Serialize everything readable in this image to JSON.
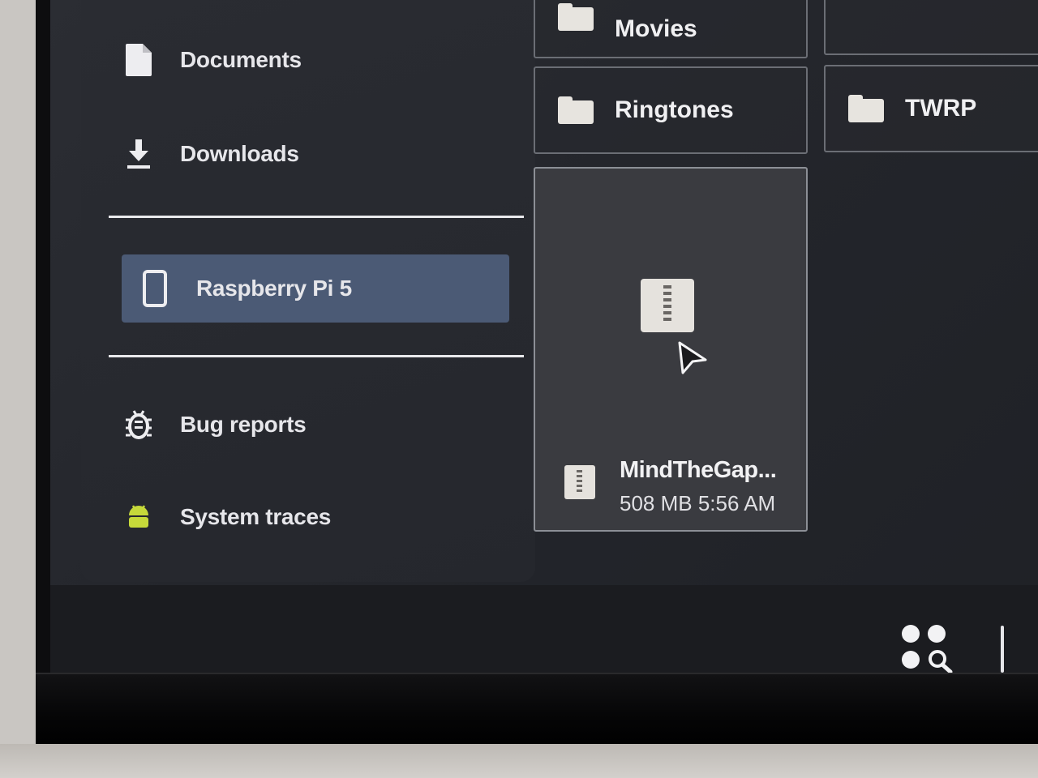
{
  "sidebar": {
    "items": [
      {
        "label": "Documents",
        "icon": "document-icon"
      },
      {
        "label": "Downloads",
        "icon": "download-icon"
      },
      {
        "label": "Raspberry Pi 5",
        "icon": "phone-device-icon",
        "selected": true
      },
      {
        "label": "Bug reports",
        "icon": "bug-icon"
      },
      {
        "label": "System traces",
        "icon": "android-icon"
      }
    ]
  },
  "folders": [
    {
      "label": "Movies",
      "icon": "folder-icon"
    },
    {
      "label": "Ringtones",
      "icon": "folder-icon"
    },
    {
      "label": "TWRP",
      "icon": "folder-icon"
    }
  ],
  "file": {
    "name": "MindTheGap...",
    "meta": "508 MB 5:56 AM",
    "icon": "zip-archive-icon"
  },
  "taskbar": {
    "launcher_icon": "app-launcher-search-icon"
  },
  "colors": {
    "selected_bg": "#4b5a75",
    "android_green": "#c6d93a",
    "background": "#25272d"
  }
}
